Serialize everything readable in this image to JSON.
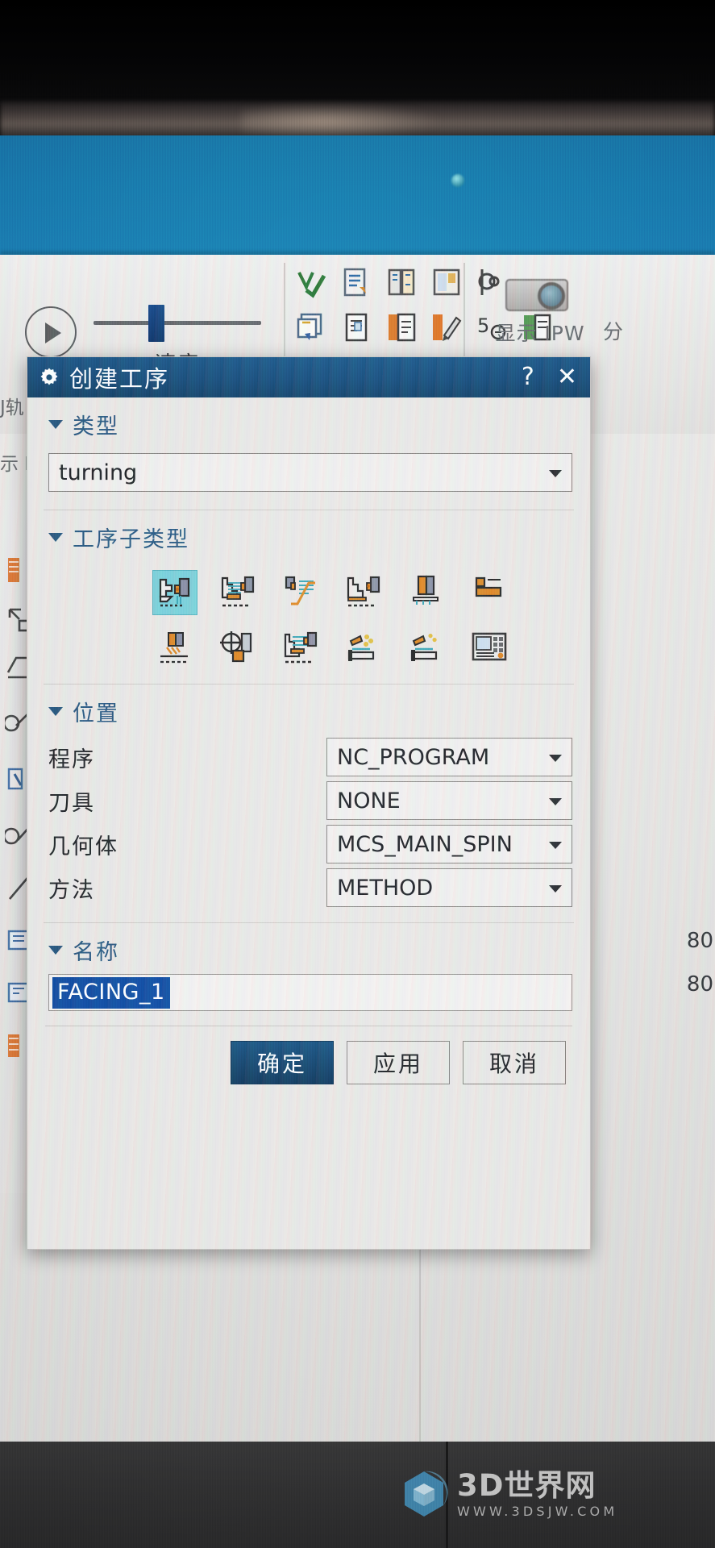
{
  "window": {
    "app_area_label": "NX CAM toolbar"
  },
  "toolbar": {
    "play_label": "播放",
    "speed_label": "速度",
    "ipw_label": "显示 IPW",
    "ipw_right_partial": "分",
    "icons_row1": [
      "verify-checkmark-icon",
      "tool-path-copy-icon",
      "tool-path-transform-icon",
      "tool-path-compare-icon",
      "tool-path-measure-icon"
    ],
    "icons_row2": [
      "copy-paste-icon",
      "list-document-icon",
      "ipw-document-icon",
      "ipw-edit-icon",
      "step-number-icon",
      "ipw-view-icon"
    ]
  },
  "background": {
    "left_texts": [
      "J轨",
      "示 I"
    ],
    "edge_numbers": [
      "80",
      "80"
    ]
  },
  "dialog": {
    "title": "创建工序",
    "title_icon": "gear-icon",
    "help_icon": "?",
    "close_icon": "✕",
    "sections": {
      "type": {
        "label": "类型",
        "value": "turning"
      },
      "subtype": {
        "label": "工序子类型",
        "icons": [
          {
            "name": "facing-icon",
            "selected": true
          },
          {
            "name": "rough-turn-od-icon",
            "selected": false
          },
          {
            "name": "rough-back-turn-icon",
            "selected": false
          },
          {
            "name": "finish-turn-od-icon",
            "selected": false
          },
          {
            "name": "teachmode-icon",
            "selected": false
          },
          {
            "name": "groove-od-icon",
            "selected": false
          },
          {
            "name": "thread-od-icon",
            "selected": false
          },
          {
            "name": "centerline-drilling-icon",
            "selected": false
          },
          {
            "name": "rough-bore-id-icon",
            "selected": false
          },
          {
            "name": "part-off-icon",
            "selected": false
          },
          {
            "name": "cylindrical-mill-icon",
            "selected": false
          },
          {
            "name": "lathe-control-icon",
            "selected": false
          }
        ]
      },
      "location": {
        "label": "位置",
        "rows": [
          {
            "label": "程序",
            "value": "NC_PROGRAM"
          },
          {
            "label": "刀具",
            "value": "NONE"
          },
          {
            "label": "几何体",
            "value": "MCS_MAIN_SPIN"
          },
          {
            "label": "方法",
            "value": "METHOD"
          }
        ]
      },
      "name": {
        "label": "名称",
        "value": "FACING_1"
      }
    },
    "buttons": {
      "ok": "确定",
      "apply": "应用",
      "cancel": "取消"
    }
  },
  "watermark": {
    "title": "3D世界网",
    "url": "WWW.3DSJW.COM",
    "logo": "cube-hexagon-logo",
    "color": "#4aa3cf"
  },
  "colors": {
    "titlebar_blue": "#1b5280",
    "accent_blue": "#1353a8",
    "selection_cyan": "#7fd3dc",
    "app_banner_blue": "#1b84b3"
  }
}
